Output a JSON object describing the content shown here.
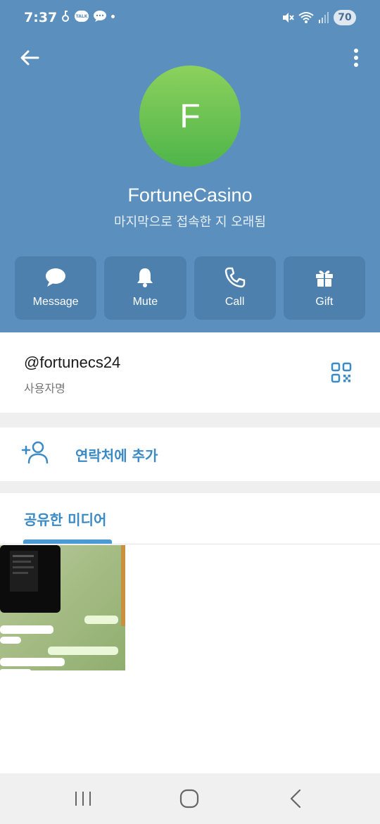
{
  "status_bar": {
    "time": "7:37",
    "talk_badge": "TALK",
    "battery": "70"
  },
  "profile": {
    "avatar_letter": "F",
    "name": "FortuneCasino",
    "last_seen": "마지막으로 접속한 지 오래됨",
    "avatar_color": "#6cc351",
    "header_color": "#5b8fbd"
  },
  "actions": [
    {
      "label": "Message",
      "icon": "chat-bubble-icon"
    },
    {
      "label": "Mute",
      "icon": "bell-icon"
    },
    {
      "label": "Call",
      "icon": "phone-icon"
    },
    {
      "label": "Gift",
      "icon": "gift-icon"
    }
  ],
  "username_info": {
    "username": "@fortunecs24",
    "caption": "사용자명"
  },
  "add_contact": {
    "label": "연락처에 추가"
  },
  "media": {
    "title": "공유한 미디어"
  },
  "accent_color": "#3a8ac6"
}
